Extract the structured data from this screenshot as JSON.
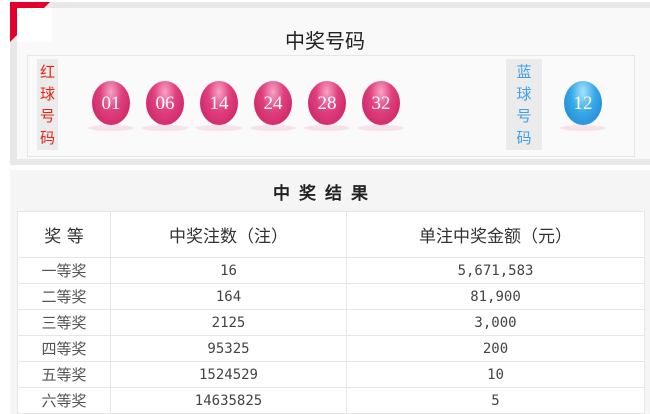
{
  "header": {
    "title": "中奖号码"
  },
  "red_label": [
    "红",
    "球",
    "号",
    "码"
  ],
  "red_balls": [
    "01",
    "06",
    "14",
    "24",
    "28",
    "32"
  ],
  "blue_label": [
    "蓝",
    "球",
    "号",
    "码"
  ],
  "blue_balls": [
    "12"
  ],
  "colors": {
    "accent": "#e4002b",
    "red_label": "#e8241a",
    "blue_label": "#3fa2e8"
  },
  "results": {
    "title": "中奖结果",
    "columns": [
      "奖 等",
      "中奖注数（注）",
      "单注中奖金额（元）"
    ],
    "rows": [
      [
        "一等奖",
        "16",
        "5,671,583"
      ],
      [
        "二等奖",
        "164",
        "81,900"
      ],
      [
        "三等奖",
        "2125",
        "3,000"
      ],
      [
        "四等奖",
        "95325",
        "200"
      ],
      [
        "五等奖",
        "1524529",
        "10"
      ],
      [
        "六等奖",
        "14635825",
        "5"
      ]
    ]
  }
}
